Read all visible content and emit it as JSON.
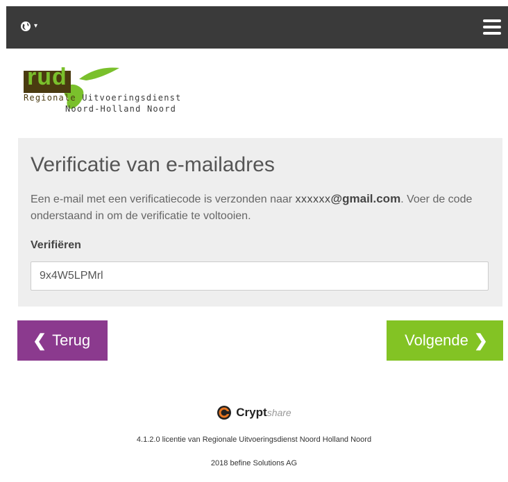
{
  "header": {
    "menu_icon": "hamburger-icon",
    "language_icon": "globe-icon"
  },
  "logo": {
    "abbrev": "rud",
    "line1_prefix": "Regionale",
    "line1_rest": " Uitvoeringsdienst",
    "line2": "Noord-Holland Noord"
  },
  "form": {
    "title": "Verificatie van e-mailadres",
    "message_before": "Een e-mail met een verificatiecode is verzonden naar ",
    "email_user": "xxxxxx",
    "email_domain": "@gmail.com",
    "message_after": ". Voer de code onderstaand in om de verificatie te voltooien.",
    "label": "Verifiëren",
    "value": "9x4W5LPMrl"
  },
  "buttons": {
    "back": "Terug",
    "next": "Volgende"
  },
  "footer": {
    "brand": "Crypt",
    "brand_suffix": "share",
    "licence": "4.1.2.0 licentie van Regionale Uitvoeringsdienst Noord Holland Noord",
    "copyright": "2018 befine Solutions AG"
  },
  "colors": {
    "topbar": "#3a3a3a",
    "back_button": "#8b3a8e",
    "next_button": "#83c324",
    "panel": "#eeeeee"
  }
}
